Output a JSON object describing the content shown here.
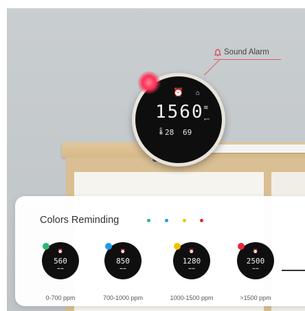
{
  "callout": {
    "label": "Sound Alarm",
    "icon": "bell-icon"
  },
  "device": {
    "reading": "1560",
    "unit": "ppm",
    "temperature": "28",
    "humidity": "69"
  },
  "card": {
    "title": "Colors Reminding",
    "dots": [
      "#2bb673",
      "#1e9be9",
      "#f2c200",
      "#e8283c"
    ],
    "levels": [
      {
        "reading": "560",
        "range": "0-700 ppm",
        "color": "#2bb673"
      },
      {
        "reading": "850",
        "range": "700-1000 ppm",
        "color": "#1e9be9"
      },
      {
        "reading": "1280",
        "range": "1000-1500 ppm",
        "color": "#f2c200"
      },
      {
        "reading": "2500",
        "range": ">1500 ppm",
        "color": "#e8283c"
      }
    ]
  }
}
